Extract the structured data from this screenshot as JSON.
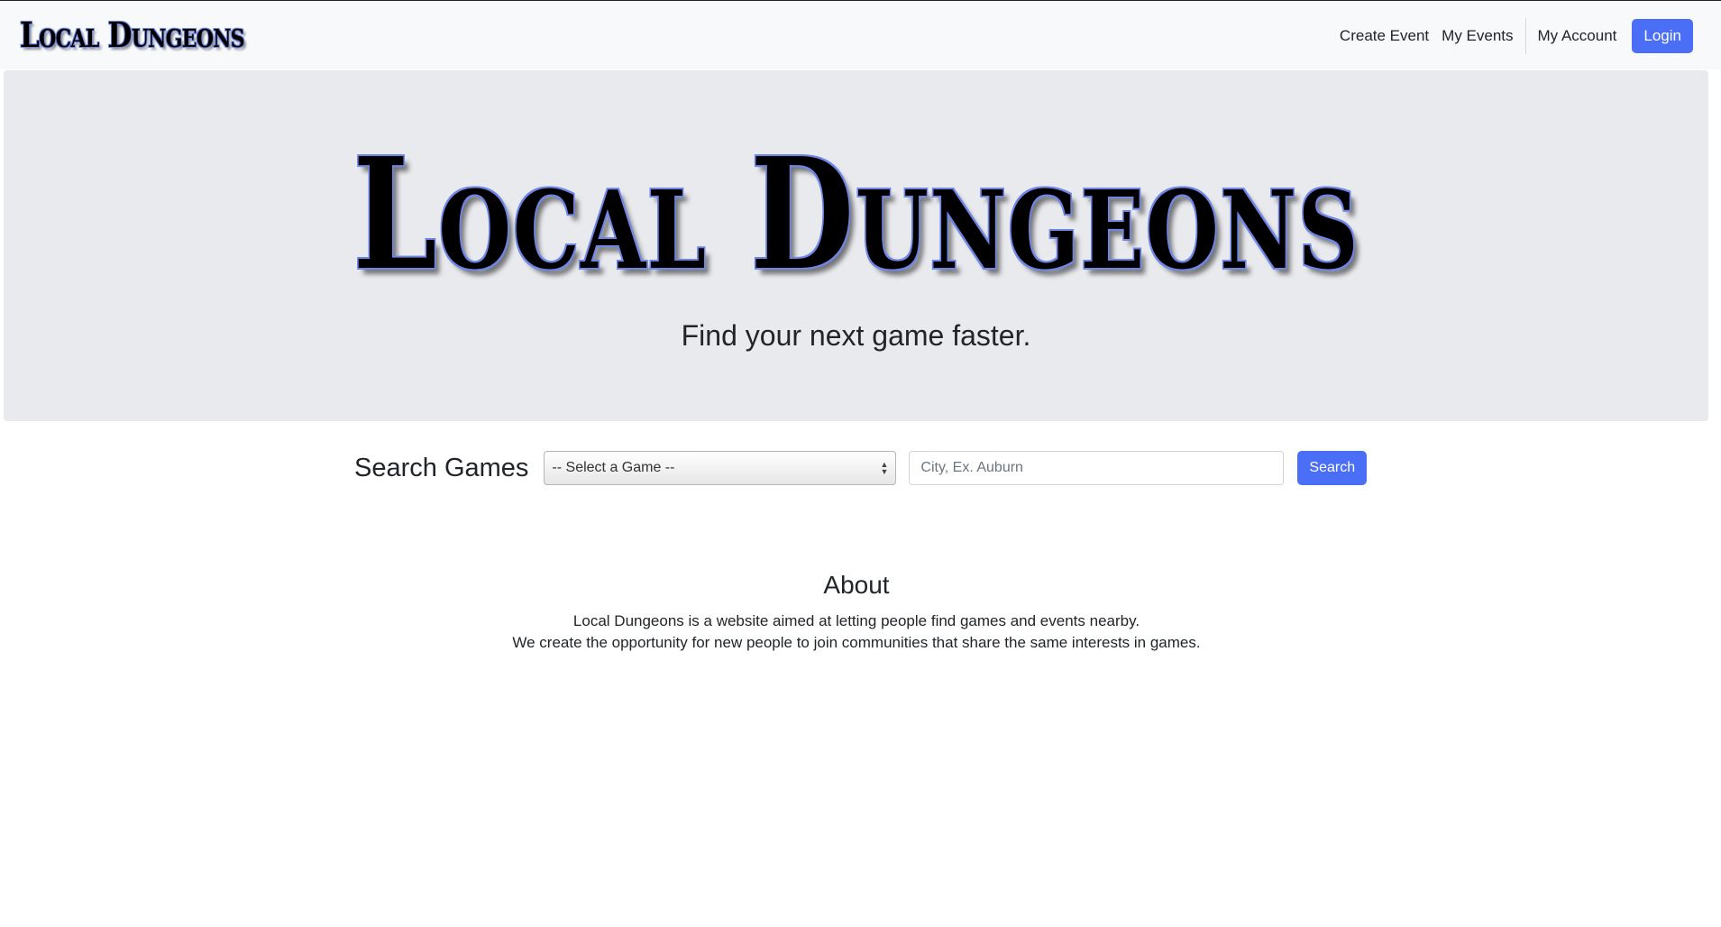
{
  "navbar": {
    "brand": "Local Dungeons",
    "links": {
      "create_event": "Create Event",
      "my_events": "My Events",
      "my_account": "My Account"
    },
    "login_label": "Login"
  },
  "hero": {
    "logo_text": "Local Dungeons",
    "tagline": "Find your next game faster."
  },
  "search": {
    "title": "Search Games",
    "game_select_value": "-- Select a Game --",
    "city_placeholder": "City, Ex. Auburn",
    "button_label": "Search"
  },
  "about": {
    "heading": "About",
    "line1": "Local Dungeons is a website aimed at letting people find games and events nearby.",
    "line2": "We create the opportunity for new people to join communities that share the same interests in games."
  },
  "colors": {
    "primary_button": "#4a6ef5",
    "navbar_bg": "#f8f9fa",
    "hero_bg": "#e9eaee",
    "logo_outline": "#6f86e6"
  }
}
